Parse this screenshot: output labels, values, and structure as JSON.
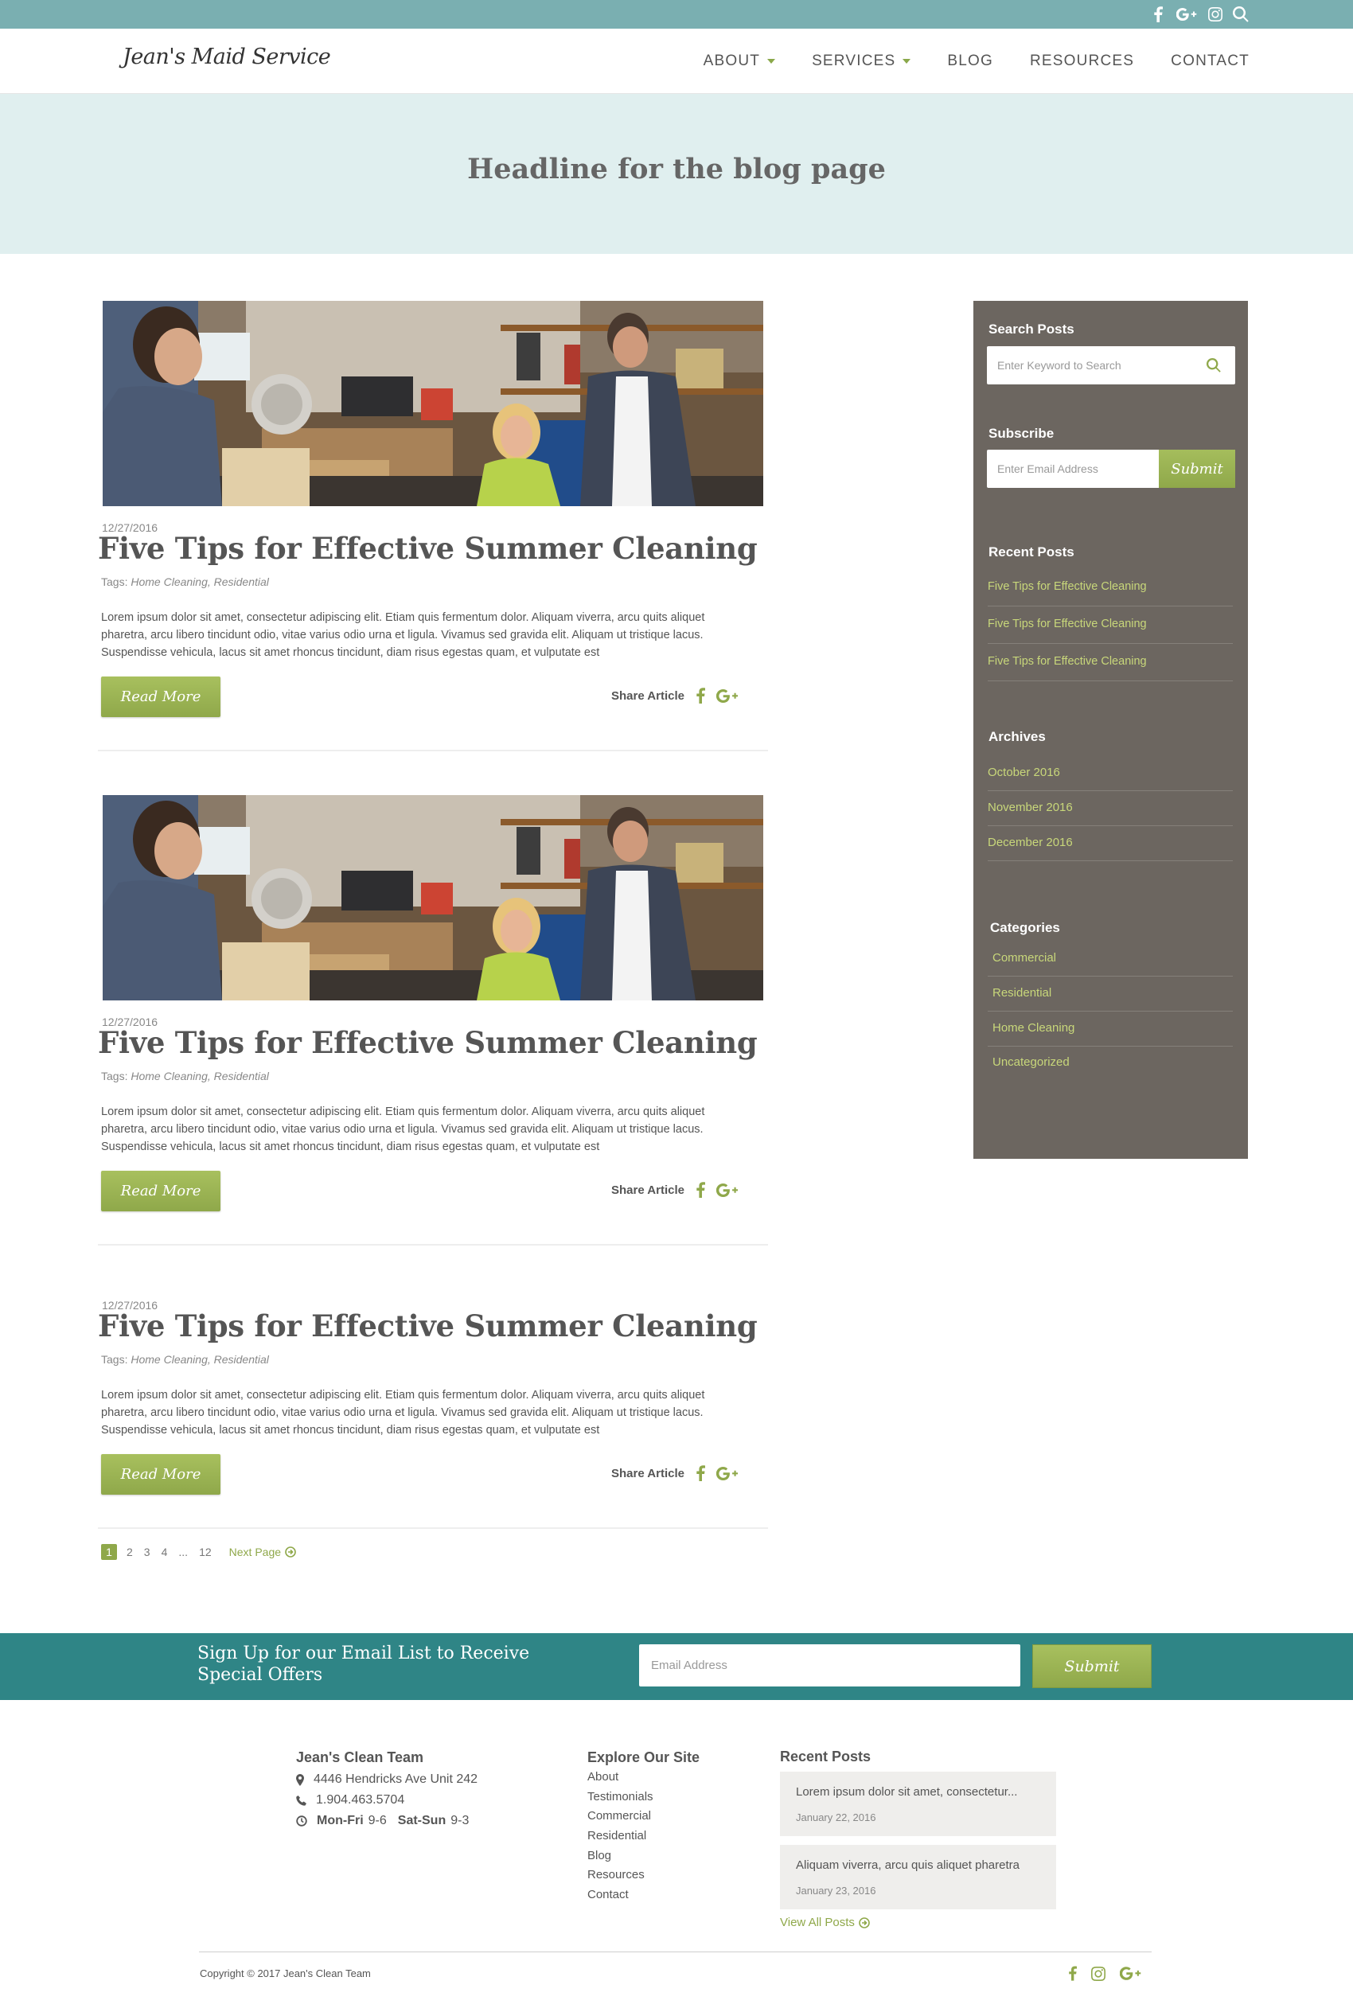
{
  "topbar": {
    "icons": [
      "facebook-icon",
      "google-plus-icon",
      "instagram-icon",
      "search-icon"
    ],
    "bg_color": "#7aafb1"
  },
  "header": {
    "logo_text": "Jean's Maid Service",
    "nav": [
      {
        "label": "ABOUT",
        "has_dropdown": true
      },
      {
        "label": "SERVICES",
        "has_dropdown": true
      },
      {
        "label": "BLOG",
        "has_dropdown": false
      },
      {
        "label": "RESOURCES",
        "has_dropdown": false
      },
      {
        "label": "CONTACT",
        "has_dropdown": false
      }
    ]
  },
  "hero": {
    "title": "Headline for the blog page"
  },
  "posts": [
    {
      "date": "12/27/2016",
      "title": "Five Tips for Effective Summer Cleaning",
      "tags_label": "Tags:",
      "tags": "Home Cleaning, Residential",
      "excerpt": "Lorem ipsum dolor sit amet, consectetur adipiscing elit. Etiam quis fermentum dolor. Aliquam viverra, arcu quits aliquet pharetra, arcu libero tincidunt odio, vitae varius odio urna et ligula. Vivamus sed gravida elit. Aliquam ut tristique lacus. Suspendisse vehicula, lacus sit amet rhoncus tincidunt, diam risus egestas quam, et vulputate est",
      "read_more": "Read More",
      "share_label": "Share Article",
      "has_image": true
    },
    {
      "date": "12/27/2016",
      "title": "Five Tips for Effective Summer Cleaning",
      "tags_label": "Tags:",
      "tags": "Home Cleaning, Residential",
      "excerpt": "Lorem ipsum dolor sit amet, consectetur adipiscing elit. Etiam quis fermentum dolor. Aliquam viverra, arcu quits aliquet pharetra, arcu libero tincidunt odio, vitae varius odio urna et ligula. Vivamus sed gravida elit. Aliquam ut tristique lacus. Suspendisse vehicula, lacus sit amet rhoncus tincidunt, diam risus egestas quam, et vulputate est",
      "read_more": "Read More",
      "share_label": "Share Article",
      "has_image": true
    },
    {
      "date": "12/27/2016",
      "title": "Five Tips for Effective Summer Cleaning",
      "tags_label": "Tags:",
      "tags": "Home Cleaning, Residential",
      "excerpt": "Lorem ipsum dolor sit amet, consectetur adipiscing elit. Etiam quis fermentum dolor. Aliquam viverra, arcu quits aliquet pharetra, arcu libero tincidunt odio, vitae varius odio urna et ligula. Vivamus sed gravida elit. Aliquam ut tristique lacus. Suspendisse vehicula, lacus sit amet rhoncus tincidunt, diam risus egestas quam, et vulputate est",
      "read_more": "Read More",
      "share_label": "Share Article",
      "has_image": false
    }
  ],
  "pagination": {
    "pages": [
      "1",
      "2",
      "3",
      "4",
      "...",
      "12"
    ],
    "current": "1",
    "next_label": "Next Page"
  },
  "sidebar": {
    "search_heading": "Search Posts",
    "search_placeholder": "Enter Keyword to Search",
    "subscribe_heading": "Subscribe",
    "subscribe_placeholder": "Enter Email Address",
    "subscribe_button": "Submit",
    "recent_heading": "Recent Posts",
    "recent_posts": [
      "Five Tips for Effective Cleaning",
      "Five Tips for Effective Cleaning",
      "Five Tips for Effective Cleaning"
    ],
    "archives_heading": "Archives",
    "archives": [
      "October 2016",
      "November 2016",
      "December 2016"
    ],
    "categories_heading": "Categories",
    "categories": [
      "Commercial",
      "Residential",
      "Home Cleaning",
      "Uncategorized"
    ],
    "bg_color": "#6c6660",
    "link_color": "#c8d77a"
  },
  "signup": {
    "text_line1": "Sign Up for our Email List to Receive",
    "text_line2": "Special Offers",
    "placeholder": "Email Address",
    "button": "Submit",
    "bg_color": "#2f8586"
  },
  "footer": {
    "company_heading": "Jean's Clean Team",
    "address": "4446 Hendricks Ave Unit 242",
    "phone": "1.904.463.5704",
    "hours_weekday_label": "Mon-Fri",
    "hours_weekday": "9-6",
    "hours_weekend_label": "Sat-Sun",
    "hours_weekend": "9-3",
    "explore_heading": "Explore Our Site",
    "explore_links": [
      "About",
      "Testimonials",
      "Commercial",
      "Residential",
      "Blog",
      "Resources",
      "Contact"
    ],
    "recent_heading": "Recent Posts",
    "recent_posts": [
      {
        "text": "Lorem ipsum dolor sit amet, consectetur...",
        "date": "January 22, 2016"
      },
      {
        "text": "Aliquam viverra, arcu quis aliquet pharetra",
        "date": "January 23, 2016"
      }
    ],
    "view_all": "View All Posts",
    "copyright": "Copyright © 2017 Jean's Clean Team",
    "social_icons": [
      "facebook-icon",
      "instagram-icon",
      "google-plus-icon"
    ]
  },
  "accent_color": "#8fa84a"
}
